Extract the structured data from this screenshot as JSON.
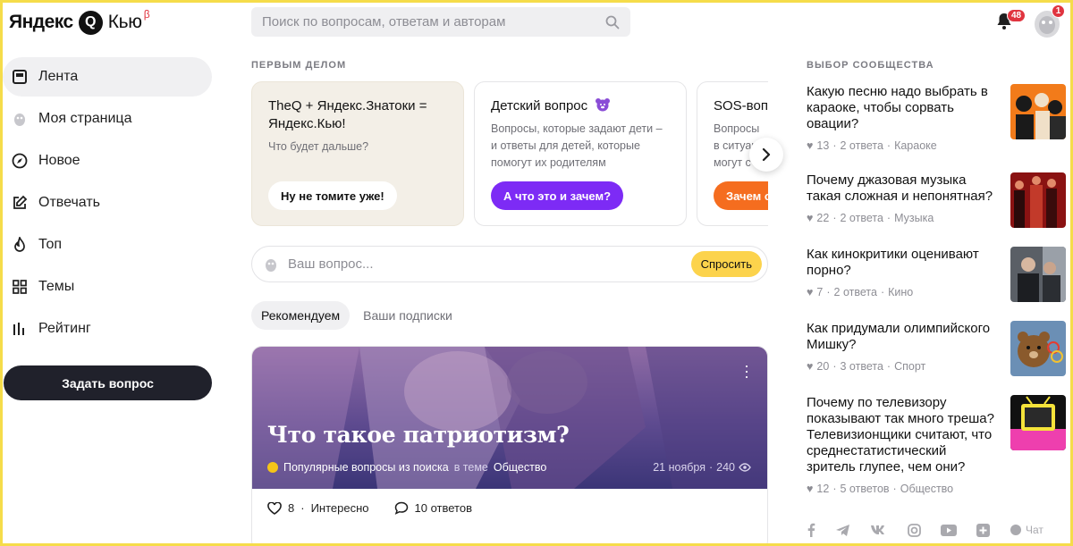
{
  "header": {
    "logo_yandex": "Яндекс",
    "logo_mark": "Q",
    "logo_kyu": "Кью",
    "logo_beta": "β",
    "search_placeholder": "Поиск по вопросам, ответам и авторам",
    "notifications_count": "48",
    "profile_badge": "1"
  },
  "sidebar": {
    "items": [
      {
        "label": "Лента",
        "icon": "feed-icon",
        "active": true
      },
      {
        "label": "Моя страница",
        "icon": "profile-icon"
      },
      {
        "label": "Новое",
        "icon": "compass-icon"
      },
      {
        "label": "Отвечать",
        "icon": "edit-icon"
      },
      {
        "label": "Топ",
        "icon": "flame-icon"
      },
      {
        "label": "Темы",
        "icon": "grid-icon"
      },
      {
        "label": "Рейтинг",
        "icon": "bars-icon"
      }
    ],
    "ask_button": "Задать вопрос"
  },
  "main": {
    "first_caption": "ПЕРВЫМ ДЕЛОМ",
    "cards": [
      {
        "title": "TheQ + Яндекс.Знатоки = Яндекс.Кью!",
        "subtitle": "Что будет дальше?",
        "button": "Ну не томите уже!"
      },
      {
        "title": "Детский вопрос",
        "subtitle": "Вопросы, которые задают дети – и ответы для детей, которые помогут их родителям",
        "button": "А что это и зачем?"
      },
      {
        "title": "SOS-вопр",
        "subtitle": "Вопросы в ситуац могут с",
        "button": "Зачем о"
      }
    ],
    "ask_placeholder": "Ваш вопрос...",
    "ask_submit": "Спросить",
    "tabs": [
      {
        "label": "Рекомендуем",
        "active": true
      },
      {
        "label": "Ваши подписки",
        "active": false
      }
    ],
    "post": {
      "title": "Что такое патриотизм?",
      "source": "Популярные вопросы из поиска",
      "in_theme": "в теме",
      "theme": "Общество",
      "date": "21 ноября",
      "views": "240",
      "likes": "8",
      "likes_label": "Интересно",
      "answers": "10 ответов"
    }
  },
  "community": {
    "caption": "ВЫБОР СООБЩЕСТВА",
    "items": [
      {
        "question": "Какую песню надо выбрать в караоке, чтобы сорвать овации?",
        "likes": "13",
        "answers": "2 ответа",
        "topic": "Караоке"
      },
      {
        "question": "Почему джазовая музыка такая сложная и непонятная?",
        "likes": "22",
        "answers": "2 ответа",
        "topic": "Музыка"
      },
      {
        "question": "Как кинокритики оценивают порно?",
        "likes": "7",
        "answers": "2 ответа",
        "topic": "Кино"
      },
      {
        "question": "Как придумали олимпийского Мишку?",
        "likes": "20",
        "answers": "3 ответа",
        "topic": "Спорт"
      },
      {
        "question": "Почему по телевизору показывают так много треша? Телевизионщики считают, что среднестатистический зритель глупее, чем они?",
        "likes": "12",
        "answers": "5 ответов",
        "topic": "Общество"
      }
    ]
  },
  "footer": {
    "chat_label": "Чат"
  },
  "colors": {
    "accent_yellow": "#fcd34c",
    "purple": "#7d2bf5",
    "orange": "#f56d1f",
    "dark_button": "#20212b",
    "badge_red": "#e0343f"
  }
}
